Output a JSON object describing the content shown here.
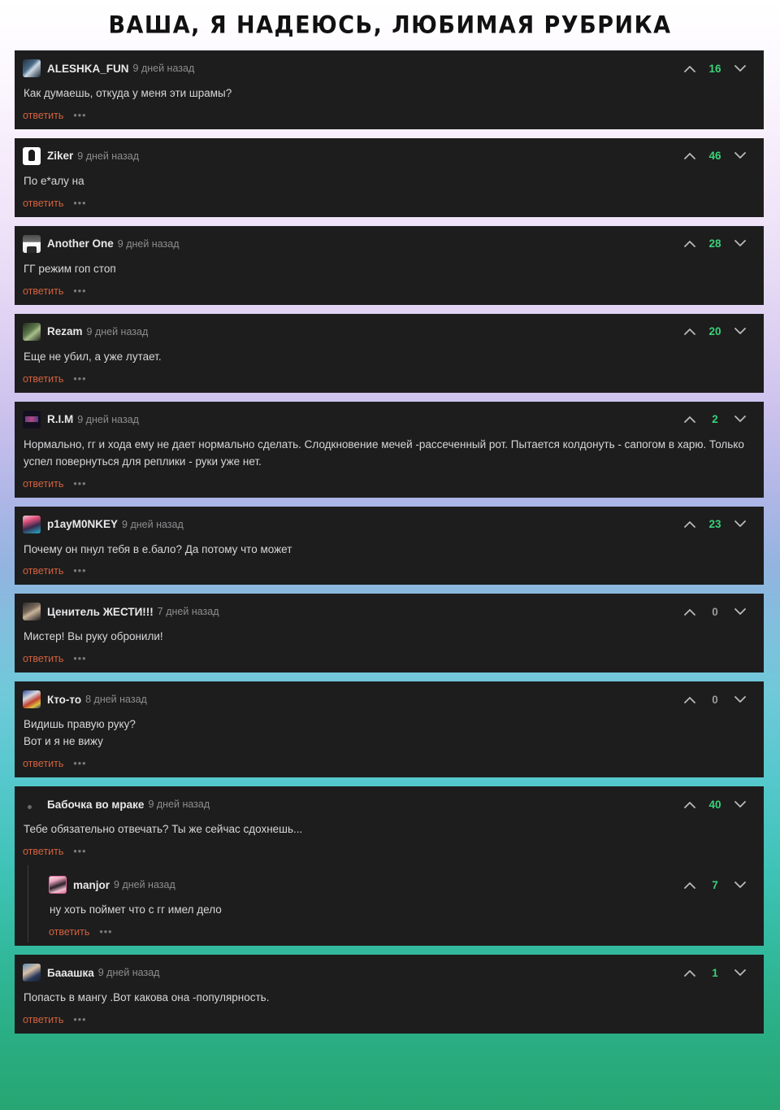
{
  "page": {
    "title": "ВАША, Я НАДЕЮСЬ, ЛЮБИМАЯ РУБРИКА"
  },
  "labels": {
    "reply": "ответить",
    "more": "•••",
    "upvote_icon": "chevron-up-icon",
    "downvote_icon": "chevron-down-icon"
  },
  "colors": {
    "comment_bg": "#1d1d1d",
    "vote_green": "#39d178",
    "reply_orange": "#d4613f",
    "username": "#e8e8ea",
    "timestamp": "#8d8d90",
    "body": "#d7d7da"
  },
  "comments": [
    {
      "username": "ALESHKA_FUN",
      "timestamp": "9 дней назад",
      "votes": "16",
      "body": "Как думаешь, откуда у меня эти шрамы?",
      "avatar": "av-a",
      "replies": []
    },
    {
      "username": "Ziker",
      "timestamp": "9 дней назад",
      "votes": "46",
      "body": "По е*алу на",
      "avatar": "av-b",
      "replies": []
    },
    {
      "username": "Another One",
      "timestamp": "9 дней назад",
      "votes": "28",
      "body": "ГГ режим гоп стоп",
      "avatar": "av-c",
      "replies": []
    },
    {
      "username": "Rezam",
      "timestamp": "9 дней назад",
      "votes": "20",
      "body": "Еще не убил, а уже лутает.",
      "avatar": "av-d",
      "replies": []
    },
    {
      "username": "R.I.M",
      "timestamp": "9 дней назад",
      "votes": "2",
      "body": "Нормально, гг и хода ему не дает нормально сделать. Слодкновение мечей -рассеченный рот. Пытается колдонуть - сапогом в харю. Только успел повернуться для реплики - руки уже нет.",
      "avatar": "av-e",
      "replies": []
    },
    {
      "username": "p1ayM0NKEY",
      "timestamp": "9 дней назад",
      "votes": "23",
      "body": "Почему он пнул тебя в е.бало? Да потому что может",
      "avatar": "av-f",
      "replies": []
    },
    {
      "username": "Ценитель ЖЕСТИ!!!",
      "timestamp": "7 дней назад",
      "votes": "0",
      "body": "Мистер! Вы руку обронили!",
      "avatar": "av-g",
      "replies": []
    },
    {
      "username": "Кто-то",
      "timestamp": "8 дней назад",
      "votes": "0",
      "body": "Видишь правую руку?\nВот и я не вижу",
      "avatar": "av-h",
      "replies": []
    },
    {
      "username": "Бабочка во мраке",
      "timestamp": "9 дней назад",
      "votes": "40",
      "body": "Тебе обязательно отвечать? Ты же сейчас сдохнешь...",
      "avatar": "av-i",
      "replies": [
        {
          "username": "manjor",
          "timestamp": "9 дней назад",
          "votes": "7",
          "body": "ну хоть поймет что с гг имел дело",
          "avatar": "av-j"
        }
      ]
    },
    {
      "username": "Бааашка",
      "timestamp": "9 дней назад",
      "votes": "1",
      "body": "Попасть в мангу .Вот какова она -популярность.",
      "avatar": "av-k",
      "replies": []
    }
  ]
}
